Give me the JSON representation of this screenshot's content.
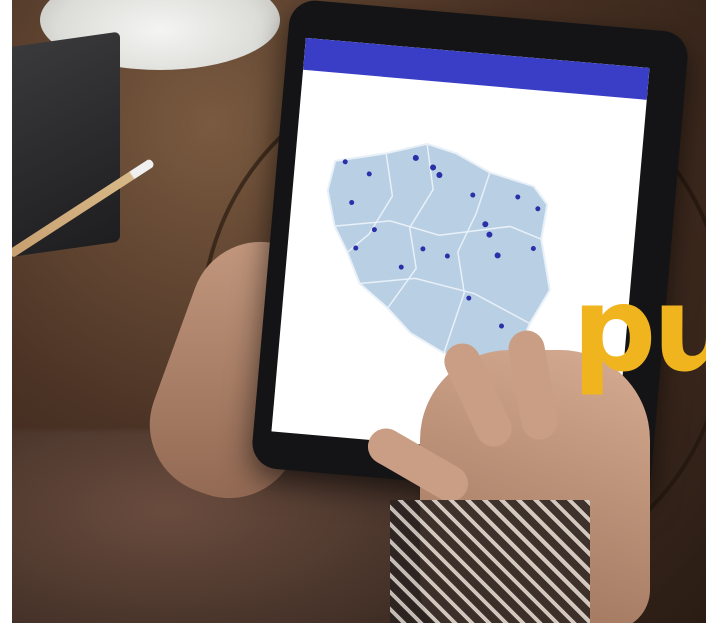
{
  "scene": {
    "description_label": "",
    "overlay_text": "pu",
    "overlay_color": "#f0b51e",
    "appbar_color": "#3a3dc6",
    "map_fill_color": "#b9cfe4",
    "map_border_color": "#e8f0f8",
    "marker_color": "#2b2fa8"
  }
}
